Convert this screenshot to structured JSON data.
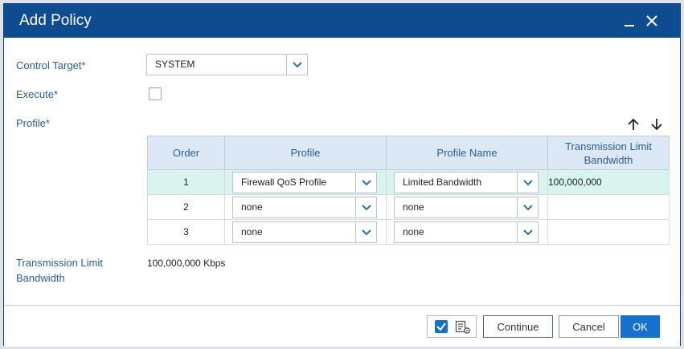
{
  "window": {
    "title": "Add Policy"
  },
  "form": {
    "control_target": {
      "label": "Control Target*",
      "value": "SYSTEM"
    },
    "execute": {
      "label": "Execute*",
      "checked": false
    },
    "profile": {
      "label": "Profile*"
    },
    "transmission_limit": {
      "label_line1": "Transmission Limit",
      "label_line2": "Bandwidth",
      "value": "100,000,000 Kbps"
    }
  },
  "table": {
    "headers": {
      "order": "Order",
      "profile": "Profile",
      "profile_name": "Profile Name",
      "bandwidth": "Transmission Limit Bandwidth"
    },
    "rows": [
      {
        "order": "1",
        "profile": "Firewall QoS Profile",
        "profile_name": "Limited Bandwidth",
        "bandwidth": "100,000,000",
        "selected": true
      },
      {
        "order": "2",
        "profile": "none",
        "profile_name": "none",
        "bandwidth": "",
        "selected": false
      },
      {
        "order": "3",
        "profile": "none",
        "profile_name": "none",
        "bandwidth": "",
        "selected": false
      }
    ]
  },
  "footer": {
    "continue_label": "Continue",
    "cancel_label": "Cancel",
    "ok_label": "OK"
  },
  "colors": {
    "titlebar": "#0f4c8f",
    "accent": "#1770c9",
    "label": "#2b5e8f",
    "header_bg": "#dce8f5",
    "selected_row": "#d9f3ef"
  },
  "icons": {
    "minimize": "minimize-icon",
    "close": "close-icon",
    "dropdown": "chevron-down-icon",
    "move_up": "arrow-up-icon",
    "move_down": "arrow-down-icon",
    "settings": "list-settings-icon"
  }
}
